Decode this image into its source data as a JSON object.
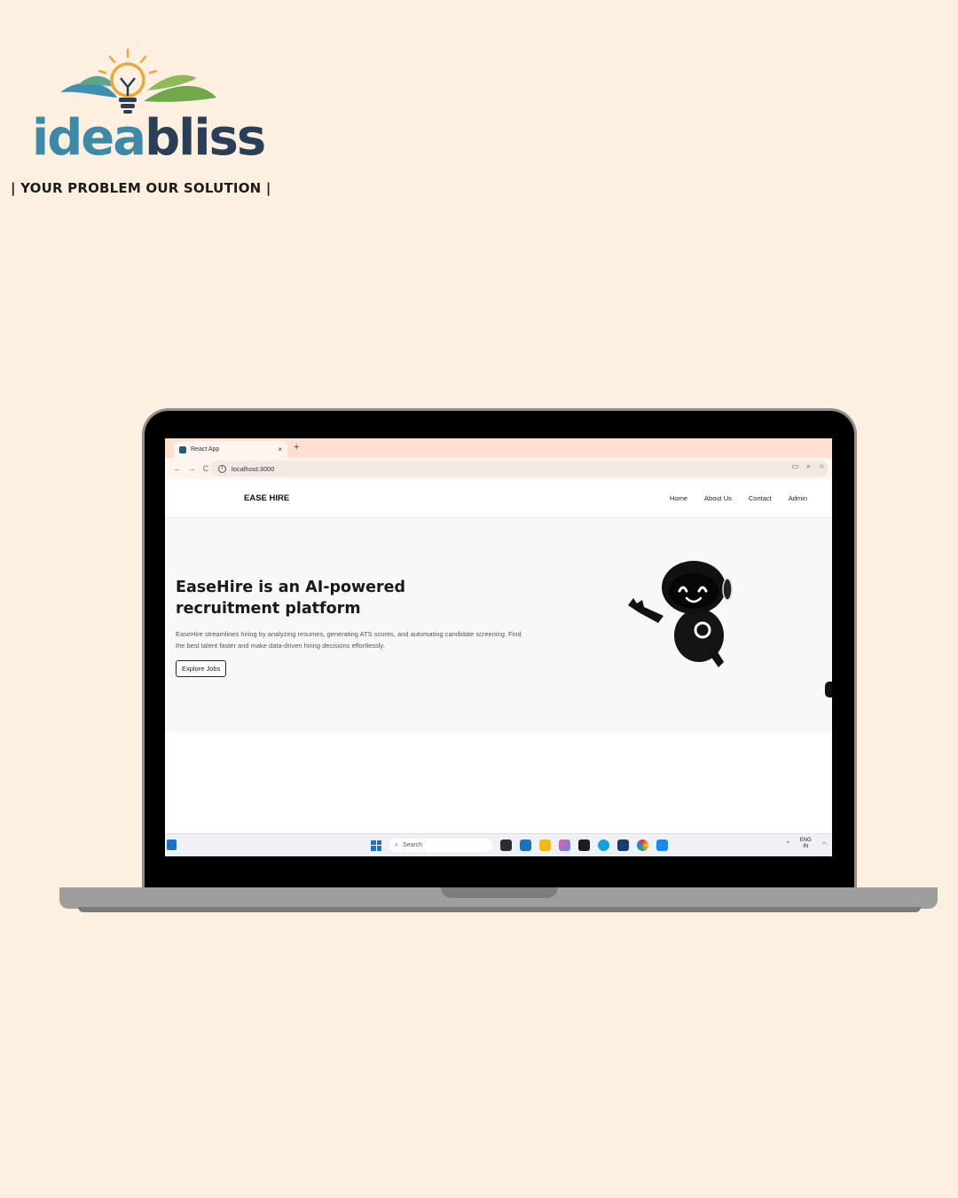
{
  "brand": {
    "logo_word_part1": "idea",
    "logo_word_part2": "bliss",
    "tagline": "| YOUR PROBLEM OUR SOLUTION |"
  },
  "browser": {
    "tab_title": "React App",
    "tab_close": "×",
    "new_tab": "+",
    "url": "localhost:3000",
    "back": "←",
    "forward": "→",
    "reload": "C"
  },
  "site": {
    "brand": "EASE HIRE",
    "nav": {
      "home": "Home",
      "about": "About Us",
      "contact": "Contact",
      "admin": "Admin"
    },
    "hero": {
      "title": "EaseHire is an AI-powered recruitment platform",
      "description": "EaseHire streamlines hiring by analyzing resumes, generating ATS scores, and automating candidate screening. Find the best talent faster and make data-driven hiring decisions effortlessly.",
      "cta": "Explore Jobs"
    }
  },
  "taskbar": {
    "search_label": "Search",
    "lang_line1": "ENG",
    "lang_line2": "IN",
    "caret": "^"
  },
  "colors": {
    "page_bg": "#fdf0e1",
    "logo_idea": "#3d8aa8",
    "logo_bliss": "#2b3e57",
    "tab_bar": "#fde0d0",
    "hero_bg": "#f7f8f9"
  },
  "icons": [
    "lightbulb-logo-icon",
    "favicon-icon",
    "back-arrow-icon",
    "forward-arrow-icon",
    "reload-icon",
    "site-info-icon",
    "install-app-icon",
    "zoom-icon",
    "bookmark-star-icon",
    "robot-mascot",
    "windows-start-icon",
    "search-icon",
    "wifi-icon"
  ]
}
